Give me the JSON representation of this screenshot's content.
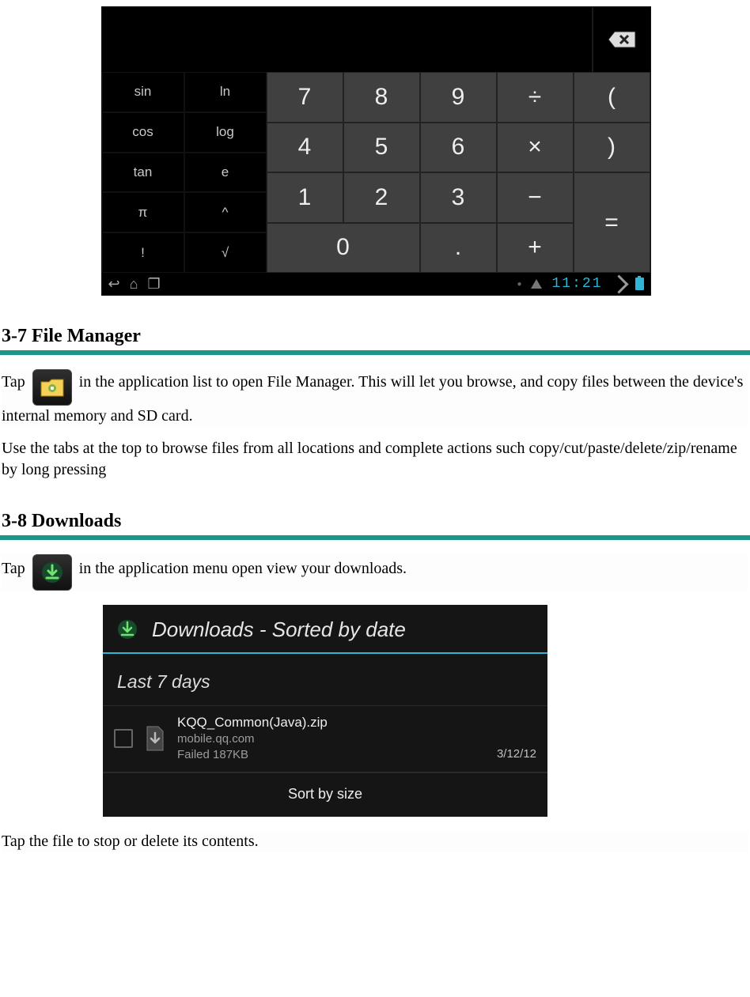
{
  "calc": {
    "expr": "",
    "sci": [
      [
        "sin",
        "ln"
      ],
      [
        "cos",
        "log"
      ],
      [
        "tan",
        "e"
      ],
      [
        "π",
        "^"
      ],
      [
        "!",
        "√"
      ]
    ],
    "grid": {
      "r1": [
        "7",
        "8",
        "9",
        "÷",
        "("
      ],
      "r2": [
        "4",
        "5",
        "6",
        "×",
        ")"
      ],
      "r3": [
        "1",
        "2",
        "3",
        "−"
      ],
      "r4": [
        "0",
        ".",
        "+"
      ],
      "eq": "="
    },
    "clock": "11:21"
  },
  "sections": {
    "fileManager": {
      "heading": "3-7 File Manager",
      "p1a": "Tap ",
      "p1b": " in the application list to open File Manager. This will let you browse, and copy files between the device's internal memory and SD card.",
      "p2": "Use the tabs at the top to browse files from all locations and complete actions such copy/cut/paste/delete/zip/rename by long pressing"
    },
    "downloads": {
      "heading": "3-8 Downloads",
      "p1a": "Tap ",
      "p1b": " in the application menu open view your downloads.",
      "footer": "Tap the file to stop or delete its contents."
    }
  },
  "dlshot": {
    "title": "Downloads - Sorted by date",
    "category": "Last 7 days",
    "item": {
      "name": "KQQ_Common(Java).zip",
      "source": "mobile.qq.com",
      "status": "Failed   187KB",
      "date": "3/12/12"
    },
    "sort": "Sort by size"
  }
}
